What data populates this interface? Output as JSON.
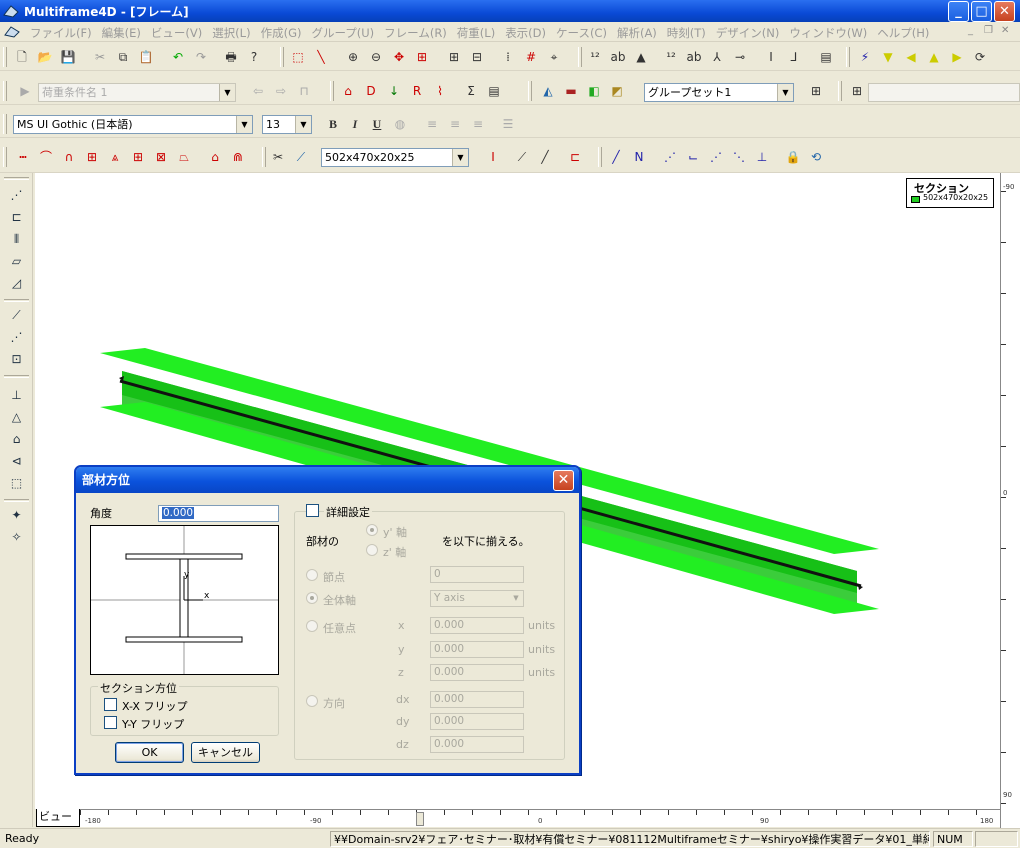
{
  "window": {
    "title": "Multiframe4D - [フレーム]",
    "minimize": "_",
    "maximize": "□",
    "close": "✕"
  },
  "menu": {
    "items": [
      "ファイル(F)",
      "編集(E)",
      "ビュー(V)",
      "選択(L)",
      "作成(G)",
      "グループ(U)",
      "フレーム(R)",
      "荷重(L)",
      "表示(D)",
      "ケース(C)",
      "解析(A)",
      "時刻(T)",
      "デザイン(N)",
      "ウィンドウ(W)",
      "ヘルプ(H)"
    ],
    "mdi_min": "_",
    "mdi_restore": "❐",
    "mdi_close": "✕"
  },
  "toolbar": {
    "load_case": "荷重条件名 1",
    "group_set": "グループセット1",
    "font_name": "MS UI Gothic (日本語)",
    "font_size": "13",
    "section_combo": "502x470x20x25",
    "bold": "B",
    "italic": "I",
    "underline": "U"
  },
  "canvas": {
    "legend_title": "セクション",
    "legend_item": "502x470x20x25",
    "beam_color": "#22ee22",
    "beam_dark": "#11aa11"
  },
  "rulers": {
    "right_labels": [
      "-90",
      "0",
      "90"
    ],
    "bottom_labels": [
      "-180",
      "-90",
      "0",
      "90",
      "180"
    ]
  },
  "view_tab": "ビュー",
  "status": {
    "ready": "Ready",
    "path": "¥¥Domain-srv2¥フェア･セミナー･取材¥有償セミナー¥081112Multiframeセミナー¥shiryo¥操作実習データ¥01_単純梁.mfd*",
    "num": "NUM"
  },
  "dialog": {
    "title": "部材方位",
    "angle_label": "角度",
    "angle_value": "0.000",
    "preview_axis_y": "y",
    "preview_axis_x": "x",
    "section_orientation_label": "セクション方位",
    "flip_xx": "X-X フリップ",
    "flip_yy": "Y-Y フリップ",
    "ok": "OK",
    "cancel": "キャンセル",
    "detail_settings": "詳細設定",
    "member_label": "部材の",
    "y_axis_opt": "y' 軸",
    "z_axis_opt": "z' 軸",
    "align_suffix": "を以下に揃える。",
    "node_label": "節点",
    "node_value": "0",
    "global_axis_label": "全体軸",
    "global_axis_value": "Y axis",
    "any_point_label": "任意点",
    "x_label": "x",
    "y_label": "y",
    "z_label": "z",
    "point_x": "0.000",
    "point_y": "0.000",
    "point_z": "0.000",
    "units": "units",
    "direction_label": "方向",
    "dx_label": "dx",
    "dy_label": "dy",
    "dz_label": "dz",
    "dir_dx": "0.000",
    "dir_dy": "0.000",
    "dir_dz": "0.000"
  }
}
